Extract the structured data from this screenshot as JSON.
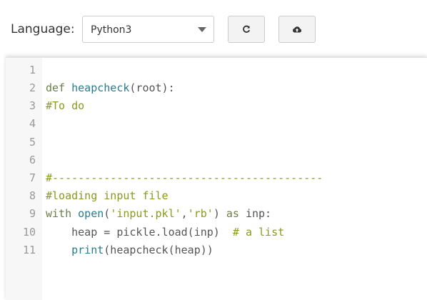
{
  "toolbar": {
    "language_label": "Language:",
    "language_value": "Python3",
    "reset_icon": "refresh-icon",
    "upload_icon": "cloud-upload-icon"
  },
  "editor": {
    "line_numbers": [
      "1",
      "2",
      "3",
      "4",
      "5",
      "6",
      "7",
      "8",
      "9",
      "10",
      "11"
    ],
    "lines": {
      "l2_kw": "def",
      "l2_fn": "heapcheck",
      "l2_rest": "(root):",
      "l3": "#To do",
      "l7": "#------------------------------------------",
      "l8": "#loading input file",
      "l9_kw": "with",
      "l9_open": "open",
      "l9_p1": "(",
      "l9_s1": "'input.pkl'",
      "l9_comma": ",",
      "l9_s2": "'rb'",
      "l9_p2": ")",
      "l9_as": "as",
      "l9_var": "inp:",
      "l10_code": "    heap = pickle.load(inp)  ",
      "l10_comment": "# a list",
      "l11_print": "print",
      "l11_rest": "(heapcheck(heap))"
    }
  },
  "colors": {
    "keyword": "#6b7f4a",
    "function": "#2a7b8c",
    "comment": "#8a9a1c",
    "gutter_bg": "#f7f7f7"
  }
}
